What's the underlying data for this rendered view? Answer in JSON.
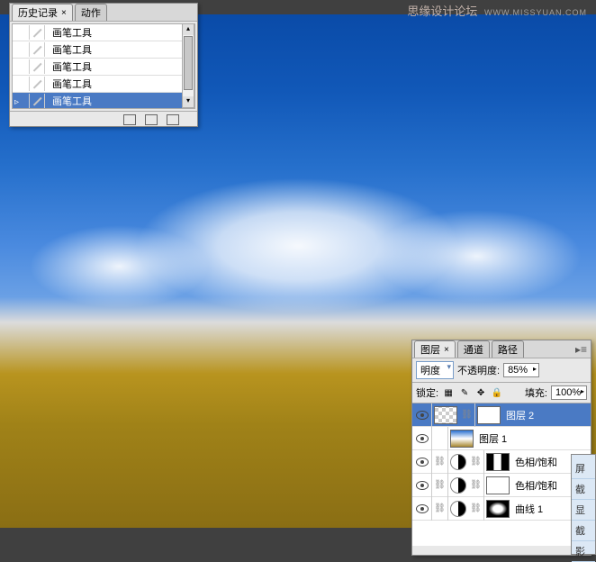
{
  "watermark": {
    "text": "思缘设计论坛",
    "url": "WWW.MISSYUAN.COM"
  },
  "history_panel": {
    "tabs": [
      {
        "label": "历史记录",
        "active": true
      },
      {
        "label": "动作",
        "active": false
      }
    ],
    "items": [
      {
        "label": "画笔工具",
        "selected": false
      },
      {
        "label": "画笔工具",
        "selected": false
      },
      {
        "label": "画笔工具",
        "selected": false
      },
      {
        "label": "画笔工具",
        "selected": false
      },
      {
        "label": "画笔工具",
        "selected": true
      }
    ]
  },
  "layers_panel": {
    "tabs": [
      {
        "label": "图层",
        "active": true
      },
      {
        "label": "通道",
        "active": false
      },
      {
        "label": "路径",
        "active": false
      }
    ],
    "blend_mode": "明度",
    "opacity_label": "不透明度:",
    "opacity_value": "85%",
    "lock_label": "锁定:",
    "fill_label": "填充:",
    "fill_value": "100%",
    "layers": [
      {
        "name": "图层 2",
        "selected": true,
        "type": "masked"
      },
      {
        "name": "图层 1",
        "selected": false,
        "type": "image"
      },
      {
        "name": "色相/饱和",
        "selected": false,
        "type": "adjustment"
      },
      {
        "name": "色相/饱和",
        "selected": false,
        "type": "adjustment"
      },
      {
        "name": "曲线 1",
        "selected": false,
        "type": "adjustment"
      }
    ]
  },
  "side_menu": {
    "items": [
      "屏",
      "截",
      "显",
      "截",
      "影"
    ]
  }
}
